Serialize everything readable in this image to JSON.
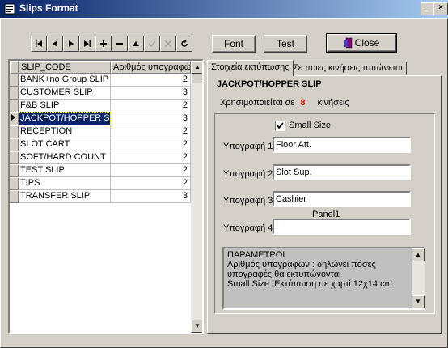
{
  "window": {
    "title": "Slips Format"
  },
  "toolbar": {
    "font_label": "Font",
    "test_label": "Test",
    "close_label": "Close"
  },
  "grid": {
    "headers": [
      "SLIP_CODE",
      "Αριθμός υπογραφών"
    ],
    "rows": [
      {
        "code": "BANK+no Group SLIP",
        "count": "2"
      },
      {
        "code": "CUSTOMER SLIP",
        "count": "3"
      },
      {
        "code": "F&B SLIP",
        "count": "2"
      },
      {
        "code": "JACKPOT/HOPPER SLIP",
        "count": "3"
      },
      {
        "code": "RECEPTION",
        "count": "2"
      },
      {
        "code": "SLOT CART",
        "count": "2"
      },
      {
        "code": "SOFT/HARD COUNT",
        "count": "2"
      },
      {
        "code": "TEST SLIP",
        "count": "2"
      },
      {
        "code": "TIPS",
        "count": "2"
      },
      {
        "code": "TRANSFER SLIP",
        "count": "3"
      }
    ]
  },
  "tabs": [
    "Στοιχεία εκτύπωσης",
    "Σε ποιες κινήσεις τυπώνεται"
  ],
  "details": {
    "slip_name": "JACKPOT/HOPPER SLIP",
    "used_prefix": "Χρησιμοποιείται σε",
    "used_count": "8",
    "used_suffix": "κινήσεις",
    "small_size_label": "Small Size",
    "sig1_label": "Υπογραφή 1",
    "sig1_value": "Floor Att.",
    "sig2_label": "Υπογραφή 2",
    "sig2_value": "Slot Sup.",
    "sig3_label": "Υπογραφή 3",
    "sig3_value": "Cashier",
    "sig4_label": "Υπογραφή 4",
    "sig4_value": "",
    "panel_caption": "Panel1",
    "memo": "ΠΑΡΑΜΕΤΡΟΙ\nΑριθμός υπογραφών : δηλώνει πόσες υπογραφές θα εκτυπώνονται\nSmall Size :Εκτύπωση σε χαρτί 12χ14 cm"
  },
  "colors": {
    "title_bar": "#0a246a",
    "selection": "#0a246a",
    "accent_red": "#e00000"
  }
}
